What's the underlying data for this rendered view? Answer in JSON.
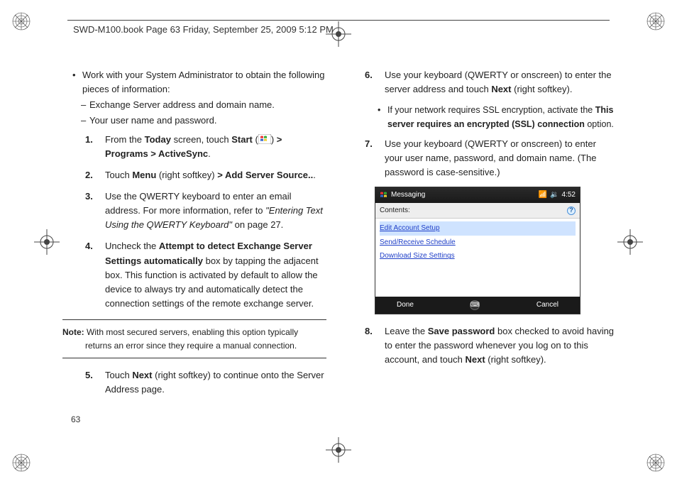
{
  "header": {
    "stamp": "SWD-M100.book  Page 63  Friday, September 25, 2009  5:12 PM"
  },
  "left": {
    "bullet": "Work with your System Administrator to obtain the following pieces of information:",
    "dash1": "Exchange Server address and domain name.",
    "dash2": "Your user name and password.",
    "s1a": "From the ",
    "s1b": "Today",
    "s1c": " screen, touch ",
    "s1d": "Start",
    "s1e": " (",
    "s1f": ") ",
    "s1g": "> Programs > ActiveSync",
    "s1h": ".",
    "s2a": "Touch ",
    "s2b": "Menu",
    "s2c": " (right softkey) ",
    "s2d": "> Add Server Source..",
    "s2e": ".",
    "s3a": "Use the QWERTY keyboard to enter an email address. For more information, refer to ",
    "s3b": "\"Entering Text Using the QWERTY Keyboard\"",
    "s3c": "  on page 27.",
    "s4a": "Uncheck the ",
    "s4b": "Attempt to detect Exchange Server Settings automatically",
    "s4c": " box by tapping the adjacent box. This function is activated by default to allow the device to always try and automatically detect the connection settings of the remote exchange server.",
    "note_label": "Note:",
    "note_body": " With most secured servers, enabling this option typically returns an error since they require a manual connection.",
    "s5a": "Touch ",
    "s5b": "Next",
    "s5c": " (right softkey) to continue onto the Server Address page."
  },
  "right": {
    "s6a": "Use your keyboard (QWERTY or onscreen) to enter the server address and touch ",
    "s6b": "Next",
    "s6c": " (right softkey).",
    "ssl_a": "If your network requires SSL encryption, activate the ",
    "ssl_b": "This server requires an encrypted (SSL) connection",
    "ssl_c": " option.",
    "s7": "Use your keyboard (QWERTY or onscreen) to enter your user name, password, and domain name. (The password is case-sensitive.)",
    "s8a": "Leave the ",
    "s8b": "Save password",
    "s8c": " box checked to avoid having to enter the password whenever you log on to this account, and touch ",
    "s8d": "Next",
    "s8e": " (right softkey)."
  },
  "screenshot": {
    "title": "Messaging",
    "time": "4:52",
    "sig": "📶",
    "vol": "🔉",
    "subtitle": "Contents:",
    "link1": "Edit Account Setup",
    "link2": "Send/Receive Schedule",
    "link3": "Download Size Settings",
    "left_soft": "Done",
    "right_soft": "Cancel"
  },
  "nums": {
    "n1": "1.",
    "n2": "2.",
    "n3": "3.",
    "n4": "4.",
    "n5": "5.",
    "n6": "6.",
    "n7": "7.",
    "n8": "8."
  },
  "page_number": "63"
}
